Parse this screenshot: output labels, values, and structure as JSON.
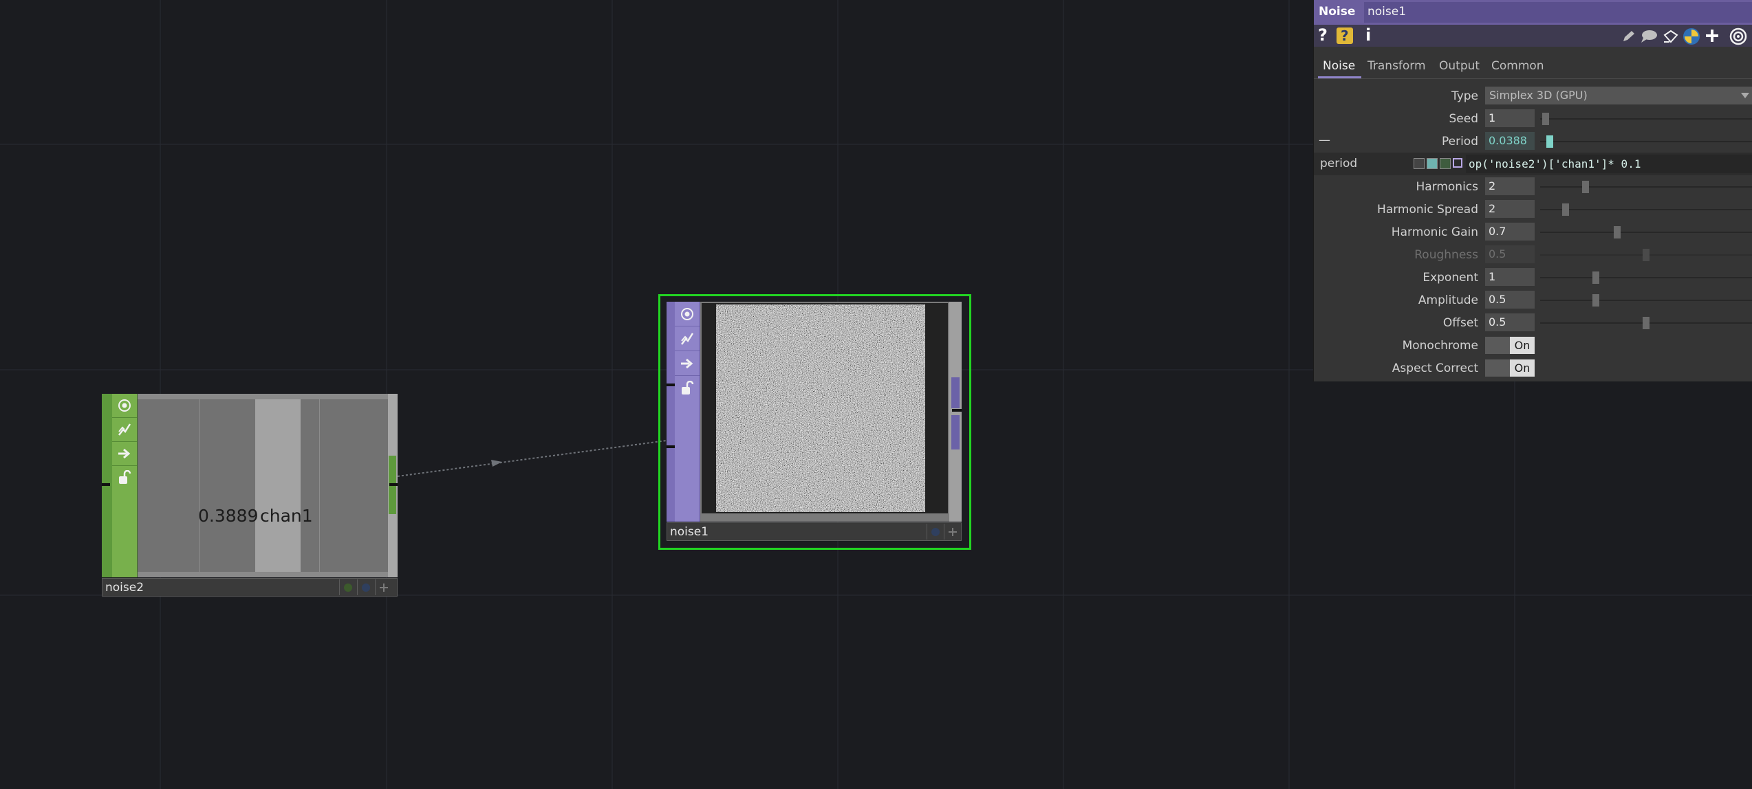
{
  "network": {
    "noise2": {
      "name": "noise2",
      "value_text": "0.3889",
      "channel_text": "chan1"
    },
    "noise1": {
      "name": "noise1"
    }
  },
  "panel": {
    "op_type": "Noise",
    "op_name": "noise1",
    "tabs": [
      "Noise",
      "Transform",
      "Output",
      "Common"
    ],
    "active_tab": "Noise",
    "type_label": "Type",
    "type_value": "Simplex 3D (GPU)",
    "params": [
      {
        "label": "Seed",
        "value": "1",
        "slider": 0.01
      },
      {
        "label": "Period",
        "value": "0.0388",
        "slider": 0.02,
        "expr": true
      }
    ],
    "expr_row": {
      "name": "period",
      "collapse_symbol": "—",
      "expression": "op('noise2')['chan1']* 0.1"
    },
    "params2": [
      {
        "label": "Harmonics",
        "value": "2",
        "slider": 0.13
      },
      {
        "label": "Harmonic Spread",
        "value": "2",
        "slider": 0.07
      },
      {
        "label": "Harmonic Gain",
        "value": "0.7",
        "slider": 0.22
      },
      {
        "label": "Roughness",
        "value": "0.5",
        "slider": 0.31,
        "disabled": true
      },
      {
        "label": "Exponent",
        "value": "1",
        "slider": 0.16
      },
      {
        "label": "Amplitude",
        "value": "0.5",
        "slider": 0.16
      },
      {
        "label": "Offset",
        "value": "0.5",
        "slider": 0.31
      }
    ],
    "toggles": [
      {
        "label": "Monochrome",
        "value": "On"
      },
      {
        "label": "Aspect Correct",
        "value": "On"
      }
    ],
    "toolbar_icons": [
      "help-icon",
      "python-help-icon",
      "info-icon",
      "edit-icon",
      "comment-icon",
      "clone-icon",
      "python-icon",
      "add-icon",
      "target-icon"
    ],
    "toolbar_glyphs": {
      "help": "?",
      "info": "i"
    }
  },
  "colors": {
    "background": "#1b1c20",
    "chop_green": "#78b04c",
    "top_purple": "#8f84c9",
    "selected_border": "#22d422",
    "expression_teal": "#7fd3c8"
  }
}
